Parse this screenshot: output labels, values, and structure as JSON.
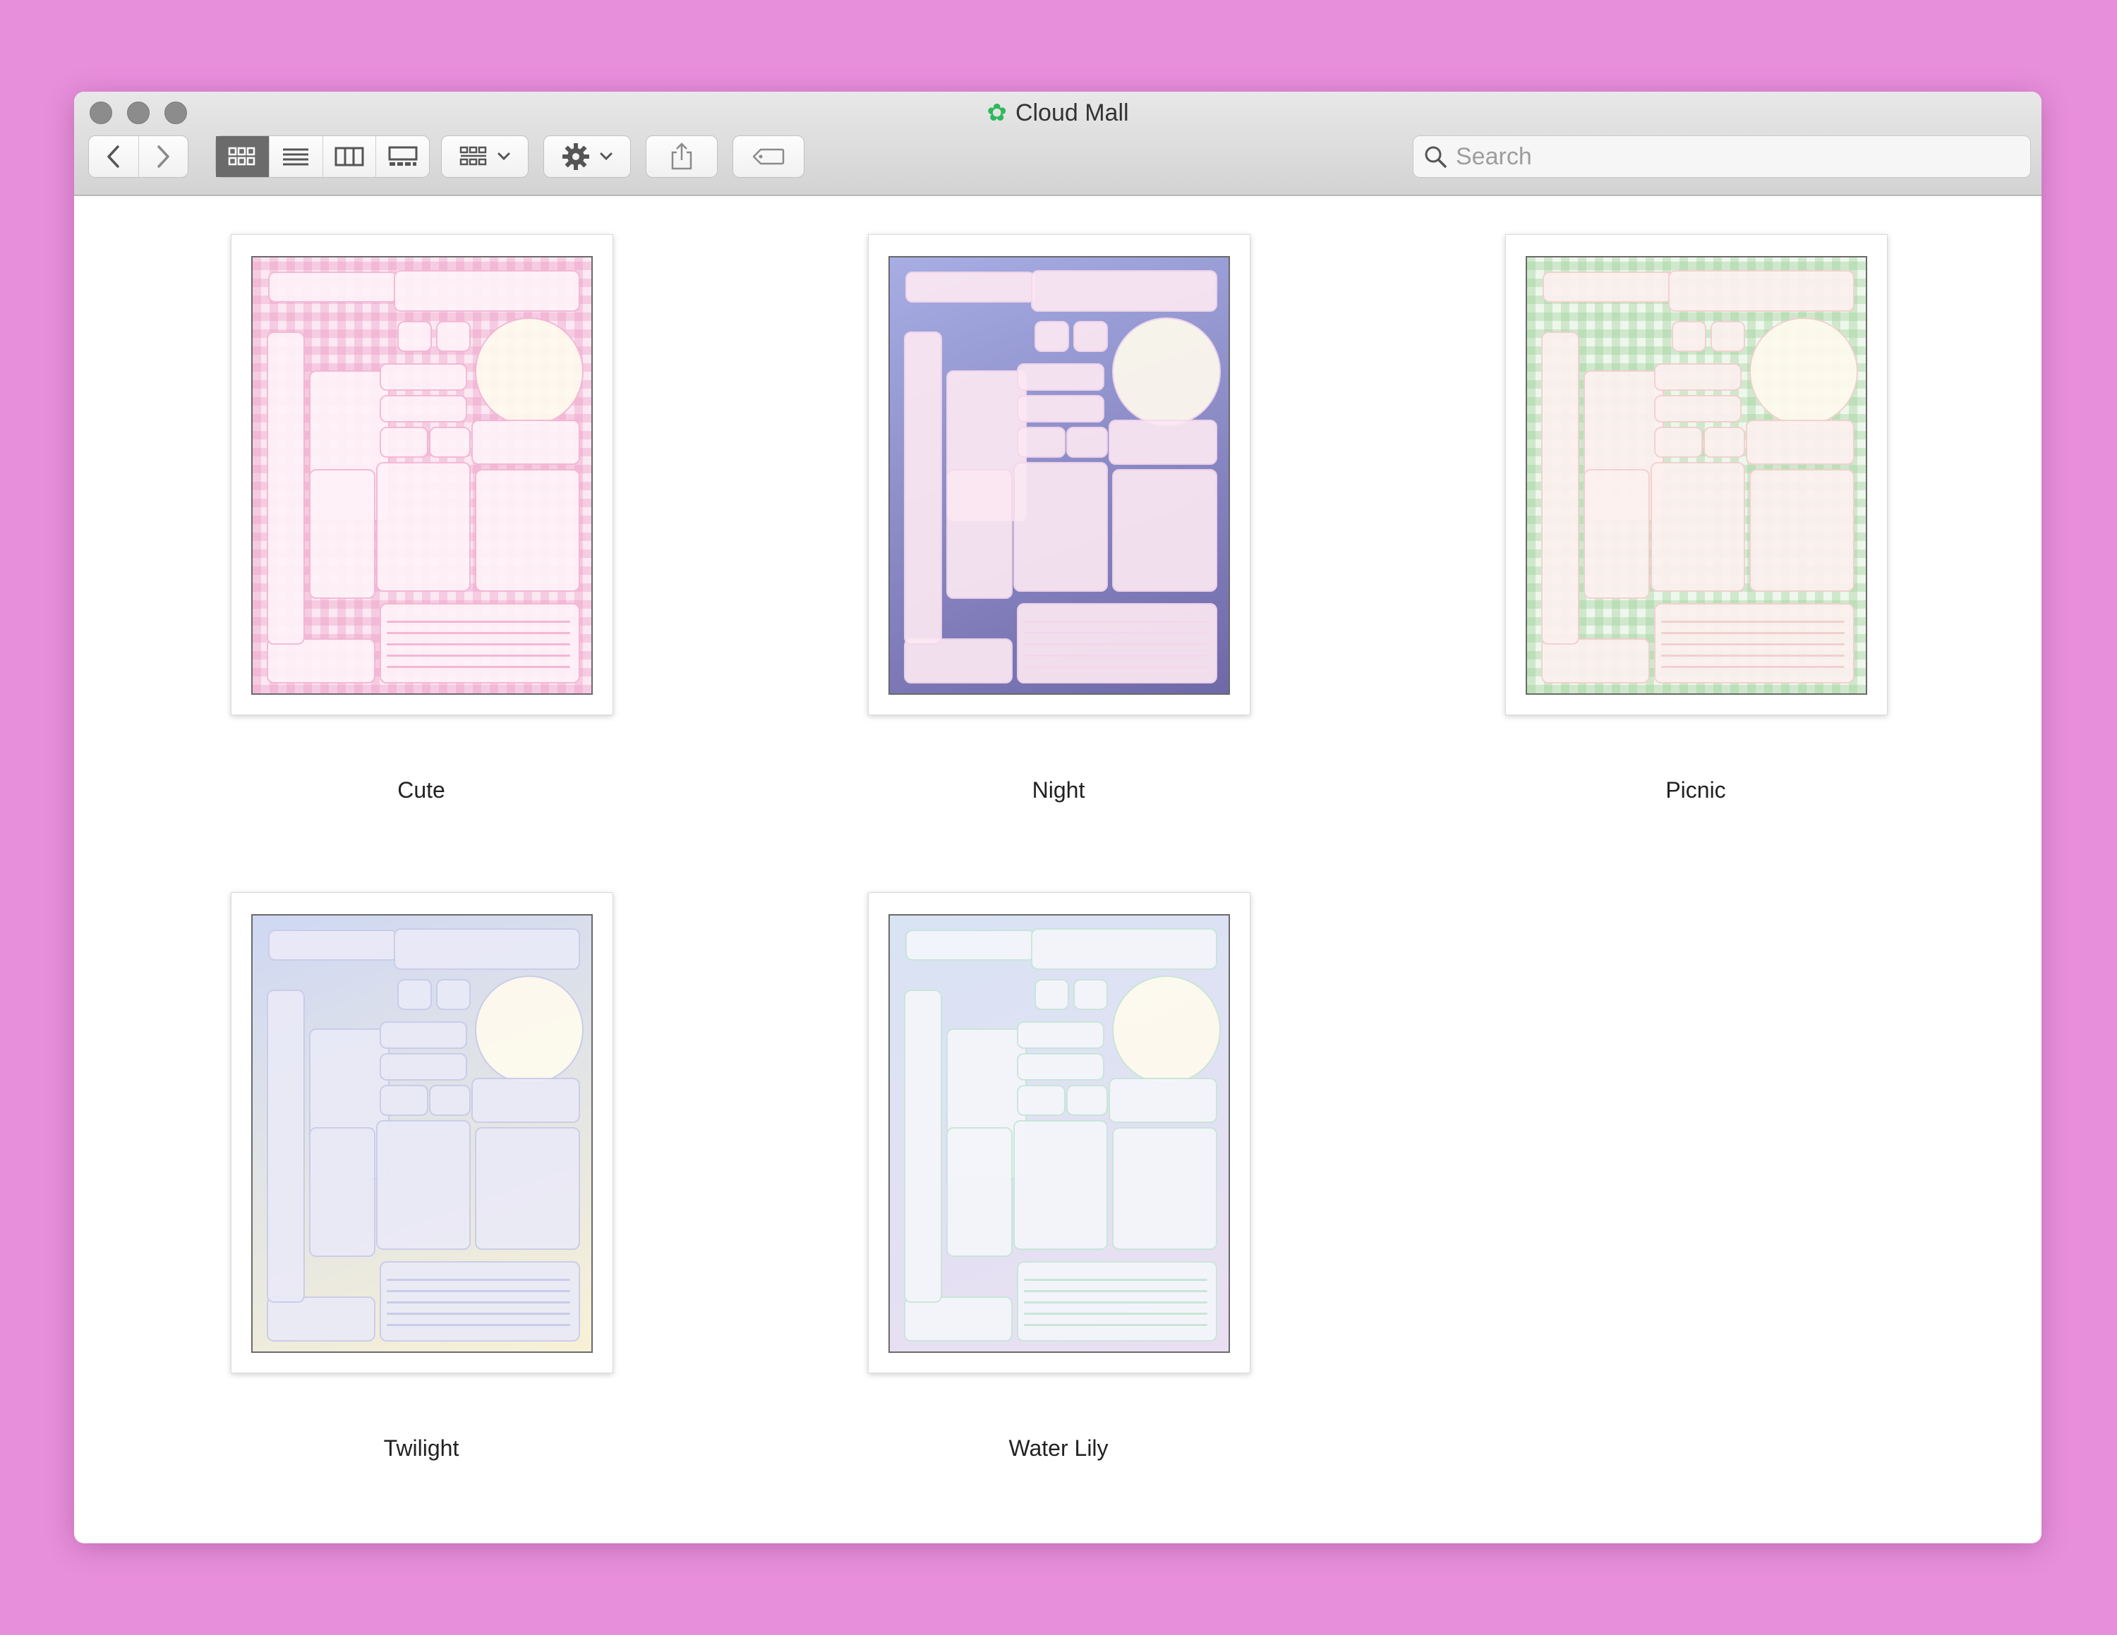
{
  "window": {
    "title": "Cloud Mall",
    "title_icon": "star-icon",
    "accent_color": "#2fb85b"
  },
  "toolbar": {
    "back_icon": "chevron-left-icon",
    "forward_icon": "chevron-right-icon",
    "view_modes": [
      "icon-view-icon",
      "list-view-icon",
      "column-view-icon",
      "gallery-view-icon"
    ],
    "active_view": "icon-view-icon",
    "group_icon": "group-by-icon",
    "action_icon": "gear-icon",
    "share_icon": "share-icon",
    "tag_icon": "tag-icon"
  },
  "search": {
    "placeholder": "Search"
  },
  "files": [
    {
      "name": "Cute",
      "theme": {
        "bg1": "#f7d6e8",
        "bg2": "#fbe8f2",
        "card": "#fff2f8",
        "accent": "#f3b7d4",
        "dark": false
      }
    },
    {
      "name": "Night",
      "theme": {
        "bg1": "#a7aee4",
        "bg2": "#6f68a8",
        "card": "#fce8f3",
        "accent": "#f4d7ec",
        "dark": true
      }
    },
    {
      "name": "Picnic",
      "theme": {
        "bg1": "#dcefd8",
        "bg2": "#eef7ec",
        "card": "#fdf1f0",
        "accent": "#f3cfcf",
        "dark": false
      }
    },
    {
      "name": "Twilight",
      "theme": {
        "bg1": "#cfd8f3",
        "bg2": "#f7f1d6",
        "card": "#eaeaf7",
        "accent": "#c9cbea",
        "dark": false
      }
    },
    {
      "name": "Water Lily",
      "theme": {
        "bg1": "#d8e3f4",
        "bg2": "#eadff2",
        "card": "#f4f6fb",
        "accent": "#c8e6d6",
        "dark": false
      }
    }
  ]
}
